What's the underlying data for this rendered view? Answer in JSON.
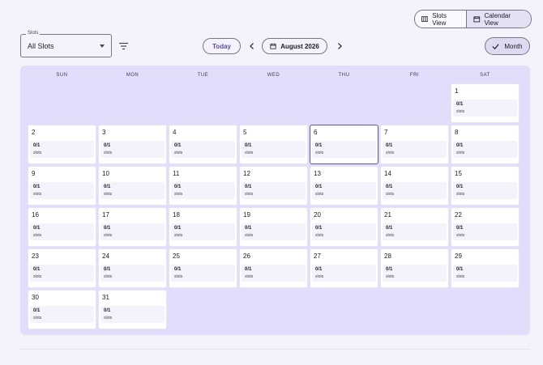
{
  "view_toggle": {
    "slots_view_label": "Slots View",
    "calendar_view_label": "Calendar View",
    "active": "calendar"
  },
  "filter": {
    "legend": "Slots",
    "value": "All Slots"
  },
  "toolbar": {
    "today_label": "Today",
    "current_month": "August 2026",
    "range_label": "Month"
  },
  "calendar": {
    "weekdays": [
      "SUN",
      "MON",
      "TUE",
      "WED",
      "THU",
      "FRI",
      "SAT"
    ],
    "first_weekday_index": 6,
    "days_in_month": 31,
    "selected_day": 6,
    "slot_count": "0/1",
    "slot_label": "slots"
  },
  "colors": {
    "accent": "#5c4f9e",
    "grid_background": "#e2ddfa",
    "selected_border": "#5c5a9e"
  }
}
